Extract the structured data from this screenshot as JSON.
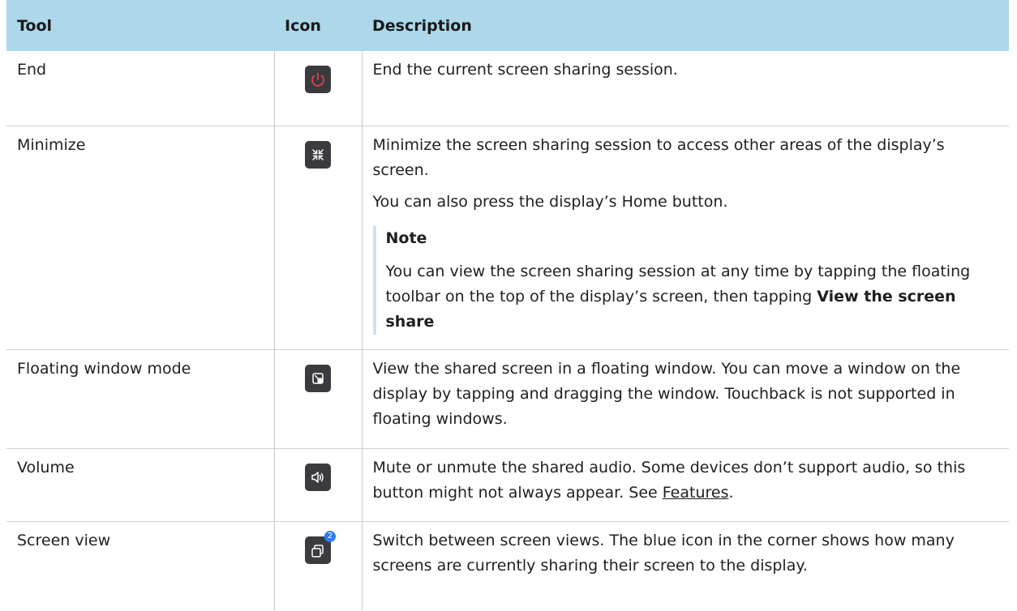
{
  "headers": {
    "tool": "Tool",
    "icon": "Icon",
    "description": "Description"
  },
  "colors": {
    "header_bg": "#acd8ea",
    "icon_bg": "#3a3a3f",
    "end_icon_red": "#e04545",
    "badge_blue": "#2f7cf6"
  },
  "rows": [
    {
      "tool": "End",
      "icon": "power-icon",
      "description": [
        "End the current screen sharing session."
      ]
    },
    {
      "tool": "Minimize",
      "icon": "minimize-icon",
      "description": [
        "Minimize the screen sharing session to access other areas of the display’s screen.",
        "You can also press the display’s Home button."
      ],
      "note": {
        "title": "Note",
        "text_before": "You can view the screen sharing session at any time by tapping the floating toolbar on the top of the display’s screen, then tapping ",
        "text_bold": "View the screen share"
      }
    },
    {
      "tool": "Floating window mode",
      "icon": "floating-window-icon",
      "description": [
        "View the shared screen in a floating window. You can move a window on the display by tapping and dragging the window. Touchback is not supported in floating windows."
      ]
    },
    {
      "tool": "Volume",
      "icon": "volume-icon",
      "description_before": "Mute or unmute the shared audio. Some devices don’t support audio, so this button might not always appear. See ",
      "link": "Features",
      "description_after": "."
    },
    {
      "tool": "Screen view",
      "icon": "screen-view-icon",
      "badge": "2",
      "description": [
        "Switch between screen views. The blue icon in the corner shows how many screens are currently sharing their screen to the display."
      ]
    }
  ]
}
